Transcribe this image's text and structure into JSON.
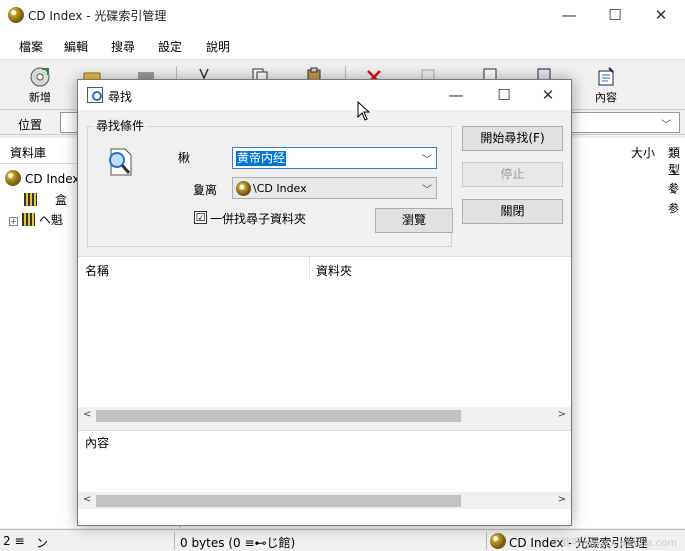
{
  "app": {
    "title": "CD Index - 光碟索引管理",
    "window_controls": {
      "minimize": "—",
      "maximize": "☐",
      "close": "✕"
    }
  },
  "menu": {
    "items": [
      "檔案",
      "編輯",
      "搜尋",
      "設定",
      "說明"
    ]
  },
  "toolbar": {
    "new_label": "新增",
    "properties_label": "內容"
  },
  "address": {
    "label": "位置"
  },
  "tree": {
    "header": "資料庫",
    "root": "CD Index",
    "items": [
      "盒",
      "ヘ魁"
    ]
  },
  "list": {
    "headers": {
      "size": "大小",
      "type": "類型"
    },
    "rows": [
      "丶参",
      "丶参"
    ]
  },
  "status": {
    "count": "2 ≡",
    "mark": "ン",
    "bytes": "0 bytes (0 ≡⊷じ館)",
    "location": "CD Index - 光碟索引管理"
  },
  "dialog": {
    "title": "尋找",
    "group_label": "尋找條件",
    "keyword_label": "楸",
    "keyword_value": "黄帝内经",
    "range_label": "夐离",
    "range_value": "\\CD Index",
    "subfolders_label": "一併找尋子資料夾",
    "subfolders_checked": "☑",
    "browse_label": "瀏覽",
    "start_label": "開始尋找(F)",
    "stop_label": "停止",
    "close_label": "關閉",
    "results_headers": {
      "name": "名稱",
      "folder": "資料夾"
    },
    "content_label": "內容"
  },
  "watermark": "下载吧 www.xiazaiba.com"
}
